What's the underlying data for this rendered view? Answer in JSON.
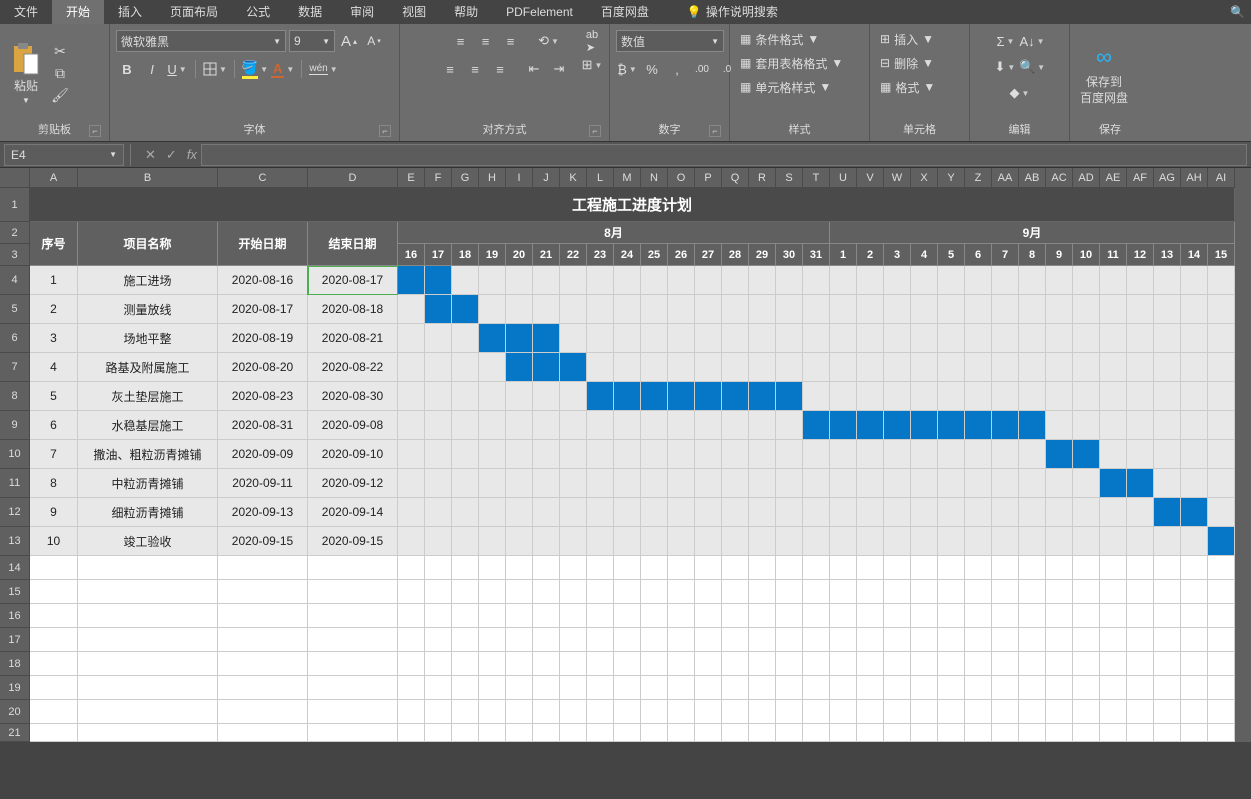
{
  "menu": {
    "items": [
      "文件",
      "开始",
      "插入",
      "页面布局",
      "公式",
      "数据",
      "审阅",
      "视图",
      "帮助",
      "PDFelement",
      "百度网盘"
    ],
    "active": 1,
    "tell": "操作说明搜索"
  },
  "ribbon": {
    "clipboard": {
      "label": "剪贴板",
      "paste": "粘贴"
    },
    "font": {
      "label": "字体",
      "name": "微软雅黑",
      "size": "9",
      "bold": "B",
      "italic": "I",
      "underline": "U",
      "wen": "wén"
    },
    "align": {
      "label": "对齐方式"
    },
    "number": {
      "label": "数字",
      "format": "数值"
    },
    "styles": {
      "label": "样式",
      "cond": "条件格式",
      "tbl": "套用表格格式",
      "cell": "单元格样式"
    },
    "cells": {
      "label": "单元格",
      "ins": "插入",
      "del": "删除",
      "fmt": "格式"
    },
    "edit": {
      "label": "编辑"
    },
    "save": {
      "label": "保存",
      "btn": "保存到\n百度网盘"
    }
  },
  "namebox": "E4",
  "cols": {
    "A": 48,
    "B": 140,
    "C": 90,
    "D": 90,
    "dayW": 27,
    "letters": [
      "A",
      "B",
      "C",
      "D",
      "E",
      "F",
      "G",
      "H",
      "I",
      "J",
      "K",
      "L",
      "M",
      "N",
      "O",
      "P",
      "Q",
      "R",
      "S",
      "T",
      "U",
      "V",
      "W",
      "X",
      "Y",
      "Z",
      "AA",
      "AB",
      "AC",
      "AD",
      "AE",
      "AF",
      "AG",
      "AH",
      "AI"
    ]
  },
  "chart_data": {
    "type": "table",
    "title": "工程施工进度计划",
    "headers": {
      "seq": "序号",
      "name": "项目名称",
      "start": "开始日期",
      "end": "结束日期",
      "month1": "8月",
      "month2": "9月"
    },
    "days": [
      "16",
      "17",
      "18",
      "19",
      "20",
      "21",
      "22",
      "23",
      "24",
      "25",
      "26",
      "27",
      "28",
      "29",
      "30",
      "31",
      "1",
      "2",
      "3",
      "4",
      "5",
      "6",
      "7",
      "8",
      "9",
      "10",
      "11",
      "12",
      "13",
      "14",
      "15"
    ],
    "rows": [
      {
        "seq": "1",
        "name": "施工进场",
        "start": "2020-08-16",
        "end": "2020-08-17",
        "fillFrom": 0,
        "fillTo": 1
      },
      {
        "seq": "2",
        "name": "测量放线",
        "start": "2020-08-17",
        "end": "2020-08-18",
        "fillFrom": 1,
        "fillTo": 2
      },
      {
        "seq": "3",
        "name": "场地平整",
        "start": "2020-08-19",
        "end": "2020-08-21",
        "fillFrom": 3,
        "fillTo": 5
      },
      {
        "seq": "4",
        "name": "路基及附属施工",
        "start": "2020-08-20",
        "end": "2020-08-22",
        "fillFrom": 4,
        "fillTo": 6
      },
      {
        "seq": "5",
        "name": "灰土垫层施工",
        "start": "2020-08-23",
        "end": "2020-08-30",
        "fillFrom": 7,
        "fillTo": 14
      },
      {
        "seq": "6",
        "name": "水稳基层施工",
        "start": "2020-08-31",
        "end": "2020-09-08",
        "fillFrom": 15,
        "fillTo": 23
      },
      {
        "seq": "7",
        "name": "撒油、粗粒沥青摊铺",
        "start": "2020-09-09",
        "end": "2020-09-10",
        "fillFrom": 24,
        "fillTo": 25
      },
      {
        "seq": "8",
        "name": "中粒沥青摊铺",
        "start": "2020-09-11",
        "end": "2020-09-12",
        "fillFrom": 26,
        "fillTo": 27
      },
      {
        "seq": "9",
        "name": "细粒沥青摊铺",
        "start": "2020-09-13",
        "end": "2020-09-14",
        "fillFrom": 28,
        "fillTo": 29
      },
      {
        "seq": "10",
        "name": "竣工验收",
        "start": "2020-09-15",
        "end": "2020-09-15",
        "fillFrom": 30,
        "fillTo": 30
      }
    ]
  }
}
